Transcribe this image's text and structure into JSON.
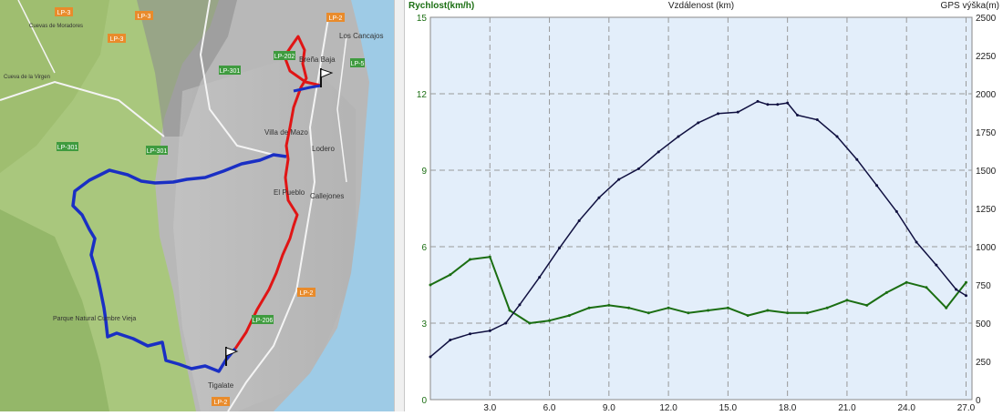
{
  "map": {
    "place_labels": [
      "Los Cancajos",
      "Breña Baja",
      "Villa de Mazo",
      "Lodero",
      "El Pueblo",
      "Callejones",
      "Parque Natural Cumbre Vieja",
      "Tigalate",
      "Cueva de la Virgen",
      "Cuevas de Moradores"
    ],
    "road_labels": [
      "LP-3",
      "LP-3",
      "LP-3",
      "LP-2",
      "LP-2",
      "LP-2",
      "LP-301",
      "LP-301",
      "LP-301",
      "LP-202",
      "LP-206",
      "LP-5"
    ],
    "colors": {
      "route_blue": "#1a2fc4",
      "route_red": "#e01515",
      "sea": "#9ecbe6",
      "forest": "#a9c77d",
      "rock": "#bdbdbd",
      "road_badge": "#e98b2b",
      "road_badge_green": "#3f9b3f"
    }
  },
  "chart_data": {
    "type": "line",
    "left_axis_title": "Rychlost(km/h)",
    "top_axis_title": "Vzdálenost (km)",
    "right_axis_title": "GPS výška(m)",
    "x_ticks": [
      "3.0",
      "6.0",
      "9.0",
      "12.0",
      "15.0",
      "18.0",
      "21.0",
      "24.0",
      "27.0"
    ],
    "y_left_ticks": [
      "0",
      "3",
      "6",
      "9",
      "12",
      "15"
    ],
    "y_right_ticks": [
      "0",
      "250",
      "500",
      "750",
      "1000",
      "1250",
      "1500",
      "1750",
      "2000",
      "2250",
      "2500"
    ],
    "xlim": [
      0,
      27.3
    ],
    "ylim_left": [
      0,
      15
    ],
    "ylim_right": [
      0,
      2500
    ],
    "grid": true,
    "series": [
      {
        "color": "#1b6e12",
        "axis": "left",
        "x": [
          0,
          1,
          2,
          3,
          4,
          5,
          6,
          7,
          8,
          9,
          10,
          11,
          12,
          13,
          14,
          15,
          16,
          17,
          18,
          19,
          20,
          21,
          22,
          23,
          24,
          25,
          26,
          27
        ],
        "y": [
          4.5,
          4.9,
          5.5,
          5.6,
          3.5,
          3.0,
          3.1,
          3.3,
          3.6,
          3.7,
          3.6,
          3.4,
          3.6,
          3.4,
          3.5,
          3.6,
          3.3,
          3.5,
          3.4,
          3.4,
          3.6,
          3.9,
          3.7,
          4.2,
          4.6,
          4.4,
          3.6,
          4.6
        ]
      },
      {
        "color": "#101040",
        "axis": "right",
        "x": [
          0,
          1,
          2,
          3,
          3.8,
          4.5,
          5.5,
          6.5,
          7.5,
          8.5,
          9.5,
          10.5,
          11.5,
          12.5,
          13.5,
          14.5,
          15.5,
          16.5,
          17,
          17.5,
          18,
          18.5,
          19.5,
          20.5,
          21.5,
          22.5,
          23.5,
          24.5,
          25.5,
          26.5,
          27
        ],
        "y": [
          280,
          390,
          430,
          450,
          500,
          620,
          800,
          990,
          1170,
          1320,
          1440,
          1510,
          1620,
          1720,
          1810,
          1870,
          1880,
          1950,
          1930,
          1930,
          1940,
          1860,
          1830,
          1720,
          1570,
          1400,
          1230,
          1030,
          880,
          720,
          680
        ]
      }
    ]
  }
}
